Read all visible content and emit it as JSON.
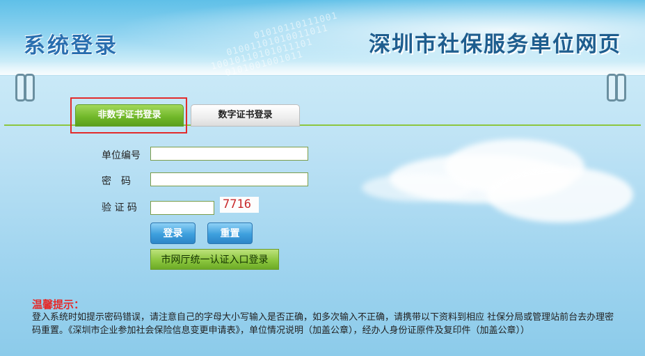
{
  "header": {
    "left_title": "系统登录",
    "right_title": "深圳市社保服务单位网页"
  },
  "tabs": [
    {
      "label": "非数字证书登录",
      "active": true
    },
    {
      "label": "数字证书登录",
      "active": false
    }
  ],
  "form": {
    "unit_label": "单位编号",
    "password_label": "密　码",
    "captcha_label": "验 证 码",
    "captcha_value": "7716",
    "unit_value": "",
    "password_value": "",
    "captcha_input_value": ""
  },
  "buttons": {
    "login": "登录",
    "reset": "重置",
    "unified_login": "市网厅统一认证入口登录"
  },
  "tips": {
    "title": "温馨提示：",
    "text": "登入系统时如提示密码错误，请注意自己的字母大小写输入是否正确，如多次输入不正确，请携带以下资料到相应 社保分局或管理站前台去办理密码重置。《深圳市企业参加社会保险信息变更申请表》，单位情况说明（加盖公章），经办人身份证原件及复印件（加盖公章））"
  },
  "colors": {
    "accent_green": "#8cc63f",
    "title_blue": "#2a6fb0",
    "tip_red": "#e52a2a",
    "highlight_red": "#e22b2b"
  }
}
